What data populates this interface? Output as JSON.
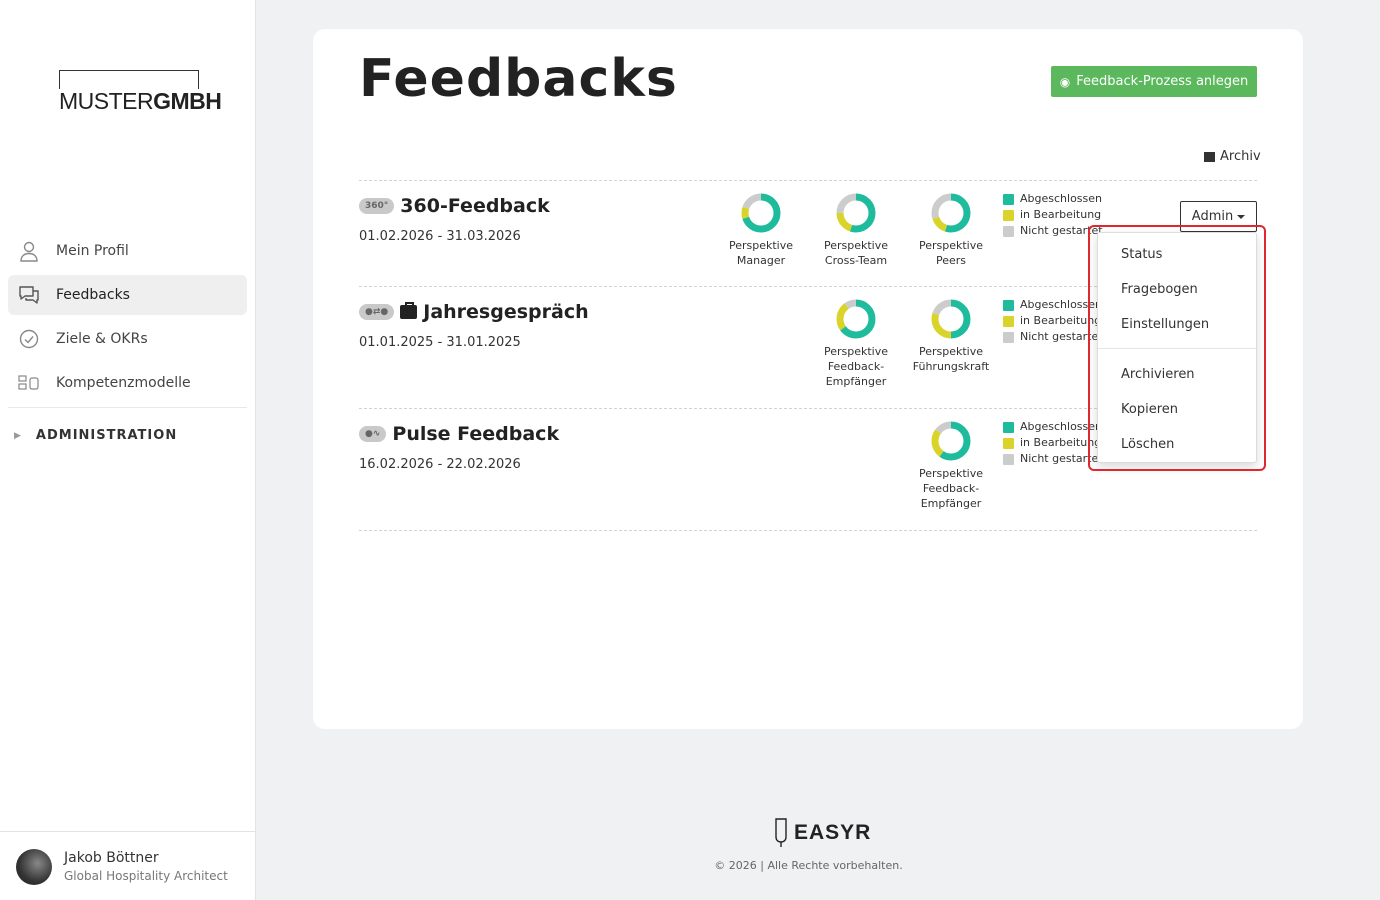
{
  "brand": {
    "logo_light": "MUSTER",
    "logo_bold": "GMBH"
  },
  "sidebar": {
    "items": [
      {
        "label": "Mein Profil",
        "icon": "user-icon"
      },
      {
        "label": "Feedbacks",
        "icon": "chat-icon",
        "active": true
      },
      {
        "label": "Ziele & OKRs",
        "icon": "check-circle-icon"
      },
      {
        "label": "Kompetenzmodelle",
        "icon": "competency-icon"
      }
    ],
    "admin_label": "ADMINISTRATION"
  },
  "user": {
    "name": "Jakob Böttner",
    "role": "Global Hospitality Architect"
  },
  "page": {
    "title": "Feedbacks",
    "create_button": "Feedback-Prozess anlegen",
    "archive_link": "Archiv"
  },
  "legend": {
    "done": "Abgeschlossen",
    "in_progress": "in Bearbeitung",
    "not_started": "Nicht gestartet"
  },
  "colors": {
    "done": "#1ebc9c",
    "in_progress": "#d9d32a",
    "not_started": "#cccccc",
    "accent": "#5cb85c",
    "highlight": "#e0262e"
  },
  "feedbacks": [
    {
      "name": "360-Feedback",
      "badge": "360°",
      "date": "01.02.2026 - 31.03.2026",
      "perspectives": [
        {
          "label_1": "Perspektive",
          "label_2": "Manager",
          "label_3": "",
          "done": 0.7,
          "in_progress": 0.1,
          "not_started": 0.2
        },
        {
          "label_1": "Perspektive",
          "label_2": "Cross-Team",
          "label_3": "",
          "done": 0.55,
          "in_progress": 0.2,
          "not_started": 0.25
        },
        {
          "label_1": "Perspektive",
          "label_2": "Peers",
          "label_3": "",
          "done": 0.55,
          "in_progress": 0.15,
          "not_started": 0.3
        }
      ]
    },
    {
      "name": "Jahresgespräch",
      "badge": "",
      "date": "01.01.2025 - 31.01.2025",
      "perspectives": [
        {
          "label_1": "Perspektive",
          "label_2": "Feedback-",
          "label_3": "Empfänger",
          "done": 0.65,
          "in_progress": 0.25,
          "not_started": 0.1
        },
        {
          "label_1": "Perspektive",
          "label_2": "Führungskraft",
          "label_3": "",
          "done": 0.5,
          "in_progress": 0.3,
          "not_started": 0.2
        }
      ]
    },
    {
      "name": "Pulse Feedback",
      "badge": "",
      "date": "16.02.2026 - 22.02.2026",
      "perspectives": [
        {
          "label_1": "Perspektive",
          "label_2": "Feedback-",
          "label_3": "Empfänger",
          "done": 0.6,
          "in_progress": 0.25,
          "not_started": 0.15
        }
      ]
    }
  ],
  "admin_menu": {
    "button": "Admin",
    "items_top": [
      "Status",
      "Fragebogen",
      "Einstellungen"
    ],
    "items_bottom": [
      "Archivieren",
      "Kopieren",
      "Löschen"
    ]
  },
  "footer": {
    "logo": "EASYR",
    "copyright": "© 2026 | Alle Rechte vorbehalten."
  }
}
